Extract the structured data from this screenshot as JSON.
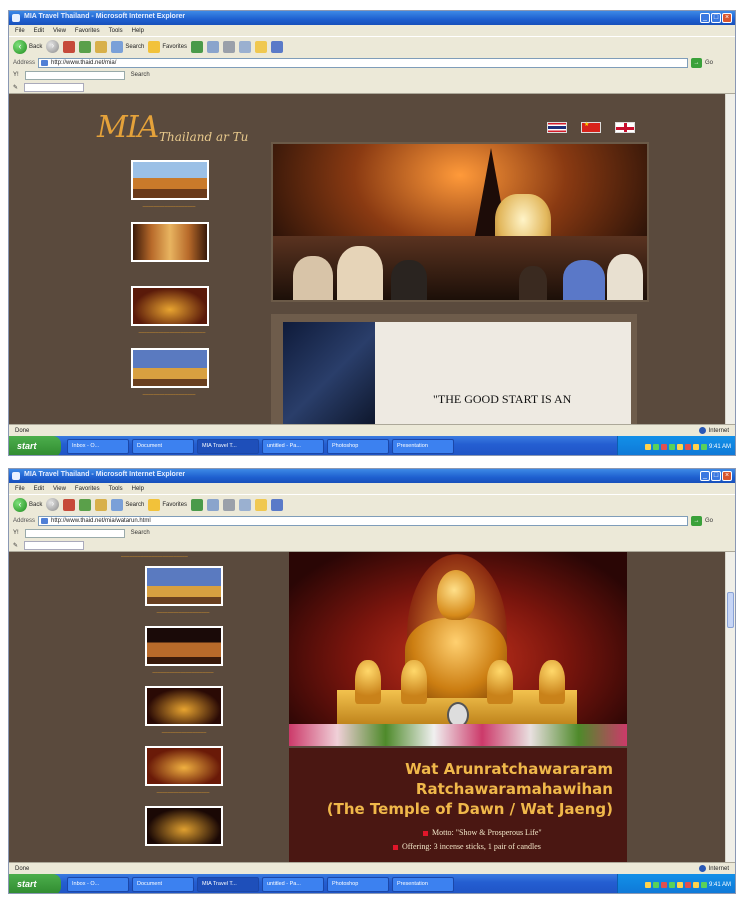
{
  "browser": {
    "menu": [
      "File",
      "Edit",
      "View",
      "Favorites",
      "Tools",
      "Help"
    ],
    "nav": {
      "back": "Back",
      "search": "Search",
      "favorites": "Favorites"
    },
    "address_label": "Address",
    "go": "Go",
    "search_toolbar_label": "Search"
  },
  "shot1": {
    "title": "MIA Travel Thailand - Microsoft Internet Explorer",
    "address": "http://www.thaid.net/mia/",
    "status_left": "Done",
    "status_zone": "Internet",
    "logo_main": "MIA",
    "logo_sub": "Thailand ar Tu",
    "quote": "\"THE GOOD START IS AN"
  },
  "shot2": {
    "title": "MIA Travel Thailand - Microsoft Internet Explorer",
    "address": "http://www.thaid.net/mia/watarun.html",
    "status_left": "Done",
    "status_zone": "Internet",
    "temple_line1": "Wat Arunratchawararam",
    "temple_line2": "Ratchawaramahawihan",
    "temple_line3": "(The Temple of Dawn / Wat Jaeng)",
    "bullet1": "Motto: \"Show & Prosperous Life\"",
    "bullet2": "Offering: 3 incense sticks, 1 pair of candles"
  },
  "taskbar": {
    "start": "start",
    "tasks1": [
      "Inbox - O...",
      "Document",
      "MIA Travel T...",
      "untitled - Pa...",
      "Photoshop",
      "Presentation"
    ],
    "tasks2": [
      "Inbox - O...",
      "Document",
      "MIA Travel T...",
      "untitled - Pa...",
      "Photoshop",
      "Presentation"
    ],
    "clock": "9:41 AM"
  },
  "colors": {
    "page_bg": "#5a4a3d",
    "accent": "#e5a23a",
    "temple_title": "#f0b84a",
    "bullet": "#e0162a"
  }
}
